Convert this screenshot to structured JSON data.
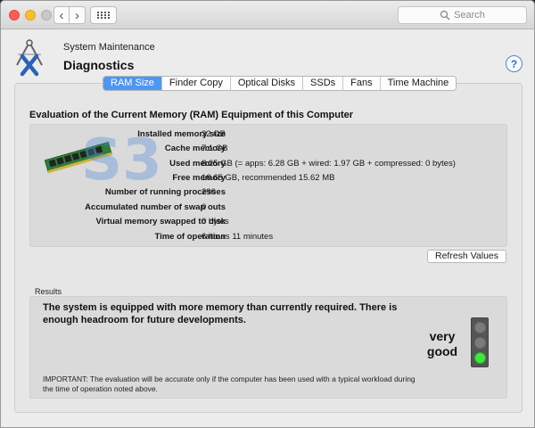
{
  "window": {
    "search_placeholder": "Search"
  },
  "header": {
    "breadcrumb": "System Maintenance",
    "title": "Diagnostics",
    "help_label": "?"
  },
  "tabs": [
    {
      "label": "RAM Size",
      "active": true
    },
    {
      "label": "Finder Copy",
      "active": false
    },
    {
      "label": "Optical Disks",
      "active": false
    },
    {
      "label": "SSDs",
      "active": false
    },
    {
      "label": "Fans",
      "active": false
    },
    {
      "label": "Time Machine",
      "active": false
    }
  ],
  "section": {
    "heading": "Evaluation of the Current Memory (RAM) Equipment of this Computer"
  },
  "memory_rows": [
    {
      "label": "Installed memory size",
      "value": "32 GB"
    },
    {
      "label": "Cache memory",
      "value": "7.1 GB"
    },
    {
      "label": "Used memory",
      "value": "8.25 GB (= apps: 6.28 GB + wired: 1.97 GB + compressed: 0 bytes)"
    },
    {
      "label": "Free memory",
      "value": "16.65 GB, recommended 15.62 MB"
    },
    {
      "label": "Number of running processes",
      "value": "290"
    },
    {
      "label": "Accumulated number of swap outs",
      "value": "0"
    },
    {
      "label": "Virtual memory swapped to disk",
      "value": "0 bytes"
    },
    {
      "label": "Time of operation",
      "value": "6 hours 11 minutes"
    }
  ],
  "refresh_button": "Refresh Values",
  "results": {
    "label": "Results",
    "message": "The system is equipped with more memory than currently required. There is enough headroom for future developments.",
    "rating_line1": "very",
    "rating_line2": "good",
    "traffic_light_active": "green",
    "important_note": "IMPORTANT: The evaluation will be accurate only if the computer has been used with a typical workload during the time of operation noted above."
  },
  "watermark_text": "S3",
  "colors": {
    "accent": "#4c97f5",
    "close": "#fc5f57",
    "minimize": "#fdbc2e",
    "light_active": "#3ee83a",
    "light_inactive": "#7b7b7b"
  },
  "icons": {
    "logo": "caliper-x-logo-icon",
    "help": "question-icon",
    "search": "magnifier-icon",
    "ram": "ram-module-icon"
  }
}
